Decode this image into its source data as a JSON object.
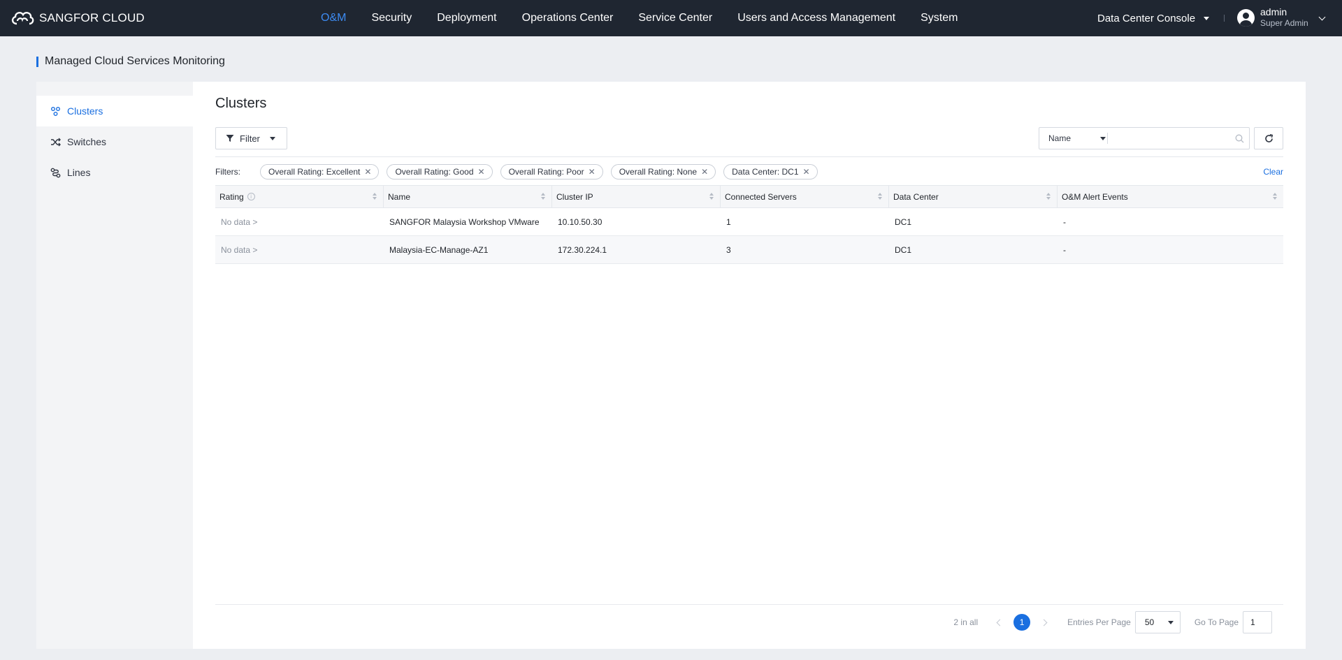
{
  "app": {
    "logo_text": "SANGFOR CLOUD",
    "nav": [
      {
        "label": "O&M",
        "active": true
      },
      {
        "label": "Security"
      },
      {
        "label": "Deployment"
      },
      {
        "label": "Operations Center"
      },
      {
        "label": "Service Center"
      },
      {
        "label": "Users and Access Management"
      },
      {
        "label": "System"
      }
    ],
    "console_label": "Data Center Console",
    "user": {
      "name": "admin",
      "role": "Super Admin"
    },
    "accent_color": "#1a6fe0"
  },
  "page": {
    "title": "Managed Cloud Services Monitoring"
  },
  "sidebar": {
    "items": [
      {
        "label": "Clusters",
        "icon": "clusters-icon",
        "active": true
      },
      {
        "label": "Switches",
        "icon": "shuffle-icon"
      },
      {
        "label": "Lines",
        "icon": "lines-icon"
      }
    ]
  },
  "main": {
    "title": "Clusters",
    "filter_button": "Filter",
    "search_field": "Name",
    "search_placeholder": "",
    "filters_label": "Filters:",
    "chips": [
      "Overall Rating: Excellent",
      "Overall Rating: Good",
      "Overall Rating: Poor",
      "Overall Rating: None",
      "Data Center: DC1"
    ],
    "clear_label": "Clear"
  },
  "table": {
    "columns": [
      "Rating",
      "Name",
      "Cluster IP",
      "Connected Servers",
      "Data Center",
      "O&M Alert Events"
    ],
    "rows": [
      {
        "rating": "No data >",
        "name": "SANGFOR Malaysia Workshop VMware",
        "ip": "10.10.50.30",
        "servers": "1",
        "dc": "DC1",
        "alerts": "-"
      },
      {
        "rating": "No data >",
        "name": "Malaysia-EC-Manage-AZ1",
        "ip": "172.30.224.1",
        "servers": "3",
        "dc": "DC1",
        "alerts": "-"
      }
    ]
  },
  "pagination": {
    "total": "2 in all",
    "current_page": "1",
    "per_page_label": "Entries Per Page",
    "per_page": "50",
    "goto_label": "Go To Page",
    "goto_value": "1"
  }
}
